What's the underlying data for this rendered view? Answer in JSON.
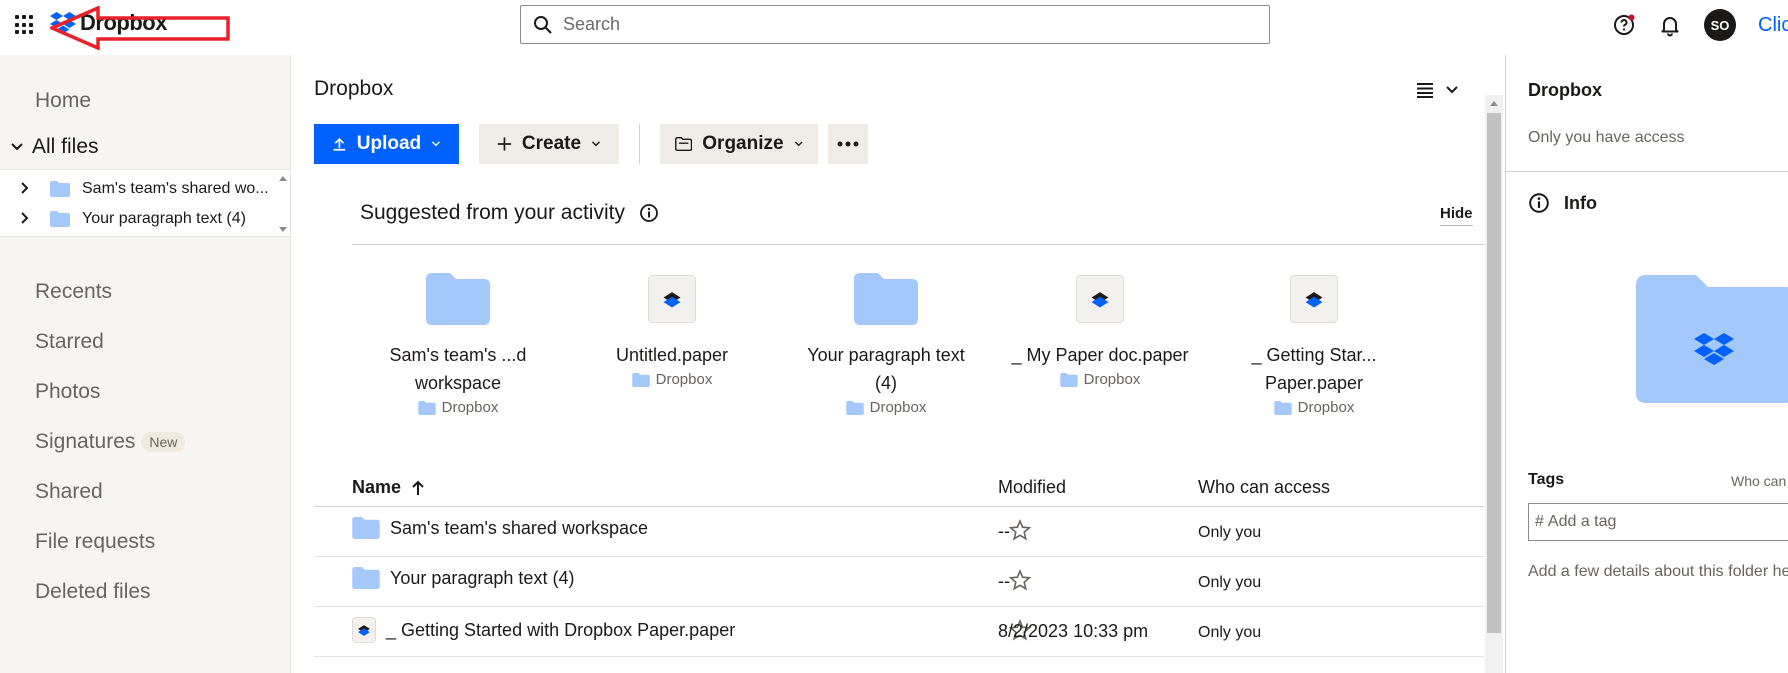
{
  "topbar": {
    "logo_text": "Dropbox",
    "search_placeholder": "Search",
    "avatar_initials": "SO",
    "partial_link": "Click"
  },
  "sidebar": {
    "items": [
      {
        "label": "Home"
      },
      {
        "label": "All files"
      },
      {
        "label": "Recents"
      },
      {
        "label": "Starred"
      },
      {
        "label": "Photos"
      },
      {
        "label": "Signatures",
        "badge": "New"
      },
      {
        "label": "Shared"
      },
      {
        "label": "File requests"
      },
      {
        "label": "Deleted files"
      }
    ],
    "tree": [
      {
        "label": "Sam's team's shared wo..."
      },
      {
        "label": "Your paragraph text (4)"
      }
    ]
  },
  "main": {
    "title": "Dropbox",
    "toolbar": {
      "upload": "Upload",
      "create": "Create",
      "organize": "Organize"
    },
    "suggested": {
      "heading": "Suggested from your activity",
      "hide": "Hide",
      "tiles": [
        {
          "name_line1": "Sam's team's ...d",
          "name_line2": "workspace",
          "location": "Dropbox",
          "kind": "folder"
        },
        {
          "name_line1": "Untitled.paper",
          "name_line2": "",
          "location": "Dropbox",
          "kind": "paper"
        },
        {
          "name_line1": "Your paragraph text",
          "name_line2": "(4)",
          "location": "Dropbox",
          "kind": "folder"
        },
        {
          "name_line1": "_ My Paper doc.paper",
          "name_line2": "",
          "location": "Dropbox",
          "kind": "paper"
        },
        {
          "name_line1": "_ Getting Star...",
          "name_line2": "Paper.paper",
          "location": "Dropbox",
          "kind": "paper"
        }
      ]
    },
    "table": {
      "columns": {
        "name": "Name",
        "modified": "Modified",
        "access": "Who can access"
      },
      "rows": [
        {
          "name": "Sam's team's shared workspace",
          "modified": "--",
          "access": "Only you",
          "kind": "folder"
        },
        {
          "name": "Your paragraph text (4)",
          "modified": "--",
          "access": "Only you",
          "kind": "folder"
        },
        {
          "name": "_ Getting Started with Dropbox Paper.paper",
          "modified": "8/2/2023 10:33 pm",
          "access": "Only you",
          "kind": "paper"
        }
      ]
    }
  },
  "details_panel": {
    "title": "Dropbox",
    "access": "Only you have access",
    "info": "Info",
    "tags_label": "Tags",
    "who_can": "Who can",
    "tag_placeholder": "Add a tag",
    "details_hint": "Add a few details about this folder he"
  },
  "colors": {
    "accent": "#0061fe",
    "folder": "#a5c8fa",
    "sidebar_bg": "#f7f5f2",
    "annotation": "#e8212b"
  }
}
